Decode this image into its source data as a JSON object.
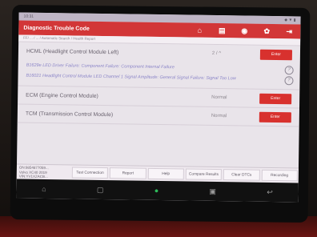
{
  "status_bar": {
    "time": "10:31",
    "right": "◆ ▼ ▮"
  },
  "title_bar": {
    "title": "Diagnostic Trouble Code"
  },
  "breadcrumb": "FF/ ... / ... / Automatic Search / Health Report",
  "modules": [
    {
      "name": "HCML (Headlight Control Module Left)",
      "status": "2 / ^",
      "enter": "Enter",
      "dtcs": [
        "B1629e LED Driver Failure: Component Failure: Component Internal Failure",
        "B16021 Headlight Control Module LED Channel 1 Signal Amplitude: General Signal Failure: Signal Too Low"
      ]
    },
    {
      "name": "ECM (Engine Control Module)",
      "status": "Normal",
      "enter": "Enter",
      "dtcs": []
    },
    {
      "name": "TCM (Transmission Control Module)",
      "status": "Normal",
      "enter": "Enter",
      "dtcs": []
    }
  ],
  "vehicle_info": [
    "ON:9854877059...",
    "Volvo XC40 2019",
    "VIN:YV1XZACB..."
  ],
  "bottom_buttons": [
    "Test Connection",
    "Report",
    "Help",
    "Compare Results",
    "Clear DTCs",
    "Recording"
  ],
  "nav": {
    "home": "⌂",
    "recent": "▢",
    "launch": "●",
    "screenshot": "▣",
    "back": "↩"
  }
}
